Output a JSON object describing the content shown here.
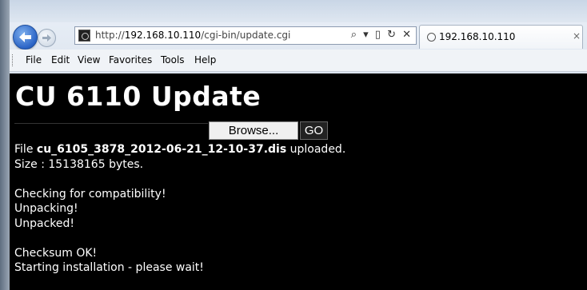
{
  "browser": {
    "url_prefix": "http://",
    "url_host": "192.168.10.110",
    "url_path": "/cgi-bin/update.cgi",
    "address_controls": "⌕ ▾ ▯ ↻ ✕",
    "tab_title": "192.168.10.110",
    "tab_close": "×",
    "menu": [
      "File",
      "Edit",
      "View",
      "Favorites",
      "Tools",
      "Help"
    ]
  },
  "page": {
    "title": "CU 6110 Update",
    "browse_label": "Browse...",
    "go_label": "GO",
    "file_prefix": "File ",
    "file_name": "cu_6105_3878_2012-06-21_12-10-37.dis",
    "file_suffix": " uploaded.",
    "log": [
      "Size : 15138165 bytes.",
      "",
      "Checking for compatibility!",
      "Unpacking!",
      "Unpacked!",
      "",
      "Checksum OK!",
      "Starting installation - please wait!"
    ]
  },
  "colors": {
    "content_bg": "#000000",
    "content_text": "#ffffff",
    "back_button": "#2b64c6"
  }
}
